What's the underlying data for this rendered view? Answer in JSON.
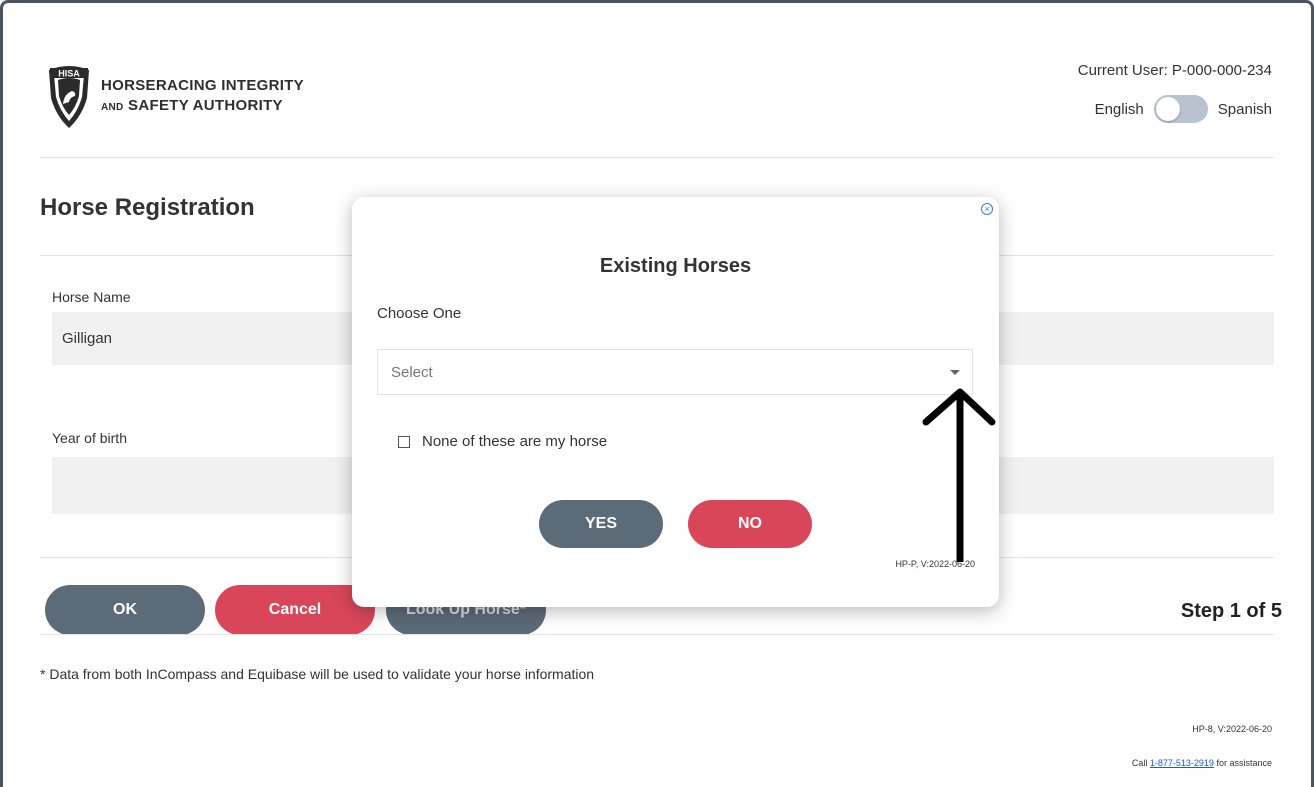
{
  "brand": {
    "shield_text": "HISA",
    "line1": "HORSERACING INTEGRITY",
    "line2_prefix": "AND",
    "line2": "SAFETY AUTHORITY"
  },
  "user": {
    "current_user": "Current User: P-000-000-234",
    "lang_left": "English",
    "lang_right": "Spanish"
  },
  "page": {
    "title": "Horse Registration",
    "fields": [
      {
        "label": "Horse Name",
        "value": "Gilligan"
      },
      {
        "label": "Year of birth",
        "value": ""
      }
    ],
    "buttons": {
      "ok": "OK",
      "cancel": "Cancel",
      "lookup": "Look Up Horse*"
    },
    "step": "Step 1 of 5",
    "note": "* Data from both InCompass and Equibase will be used to validate your horse information",
    "version": "HP-8, V:2022-06-20",
    "call_prefix": "Call",
    "phone": "1-877-513-2919",
    "call_suffix": "for assistance"
  },
  "modal": {
    "title": "Existing Horses",
    "choose_label": "Choose One",
    "select_placeholder": "Select",
    "checkbox_label": "None of these are my horse",
    "yes": "YES",
    "no": "NO",
    "version": "HP-P, V:2022-06-20"
  },
  "colors": {
    "gray_button": "#5c6b78",
    "red_button": "#d9465a",
    "toggle": "#b8c3d0",
    "link": "#1a5bd8"
  }
}
